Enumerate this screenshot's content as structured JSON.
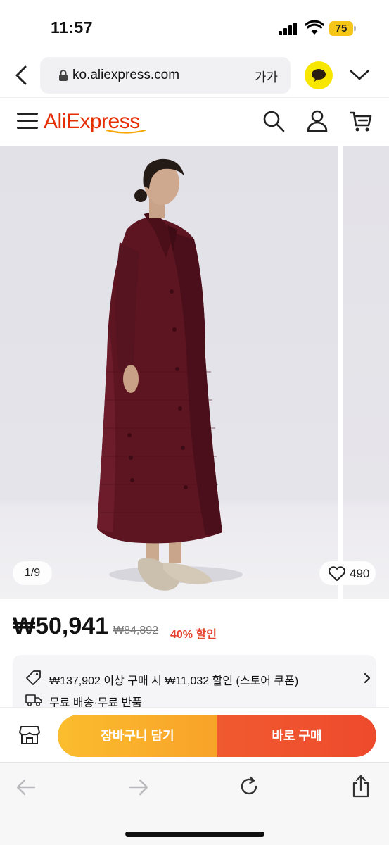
{
  "status_bar": {
    "time": "11:57",
    "battery": "75"
  },
  "browser": {
    "url": "ko.aliexpress.com",
    "text_size_label": "가가"
  },
  "site_header": {
    "logo": "AliExpress"
  },
  "gallery": {
    "page_counter": "1/9",
    "wishlist_count": "490"
  },
  "price": {
    "current": "₩50,941",
    "original": "₩84,892",
    "discount": "40% 할인"
  },
  "coupon": {
    "text": "₩137,902 이상 구매 시 ₩11,032 할인 (스토어 쿠폰)",
    "shipping": "무료 배송·무료 반품"
  },
  "actions": {
    "add_to_cart": "장바구니 담기",
    "buy_now": "바로 구매"
  },
  "colors": {
    "brand": "#e62e04",
    "cart_button": "#f8a229",
    "buy_button": "#ee4a2c",
    "discount": "#e6402d",
    "garment": "#5e1522"
  }
}
